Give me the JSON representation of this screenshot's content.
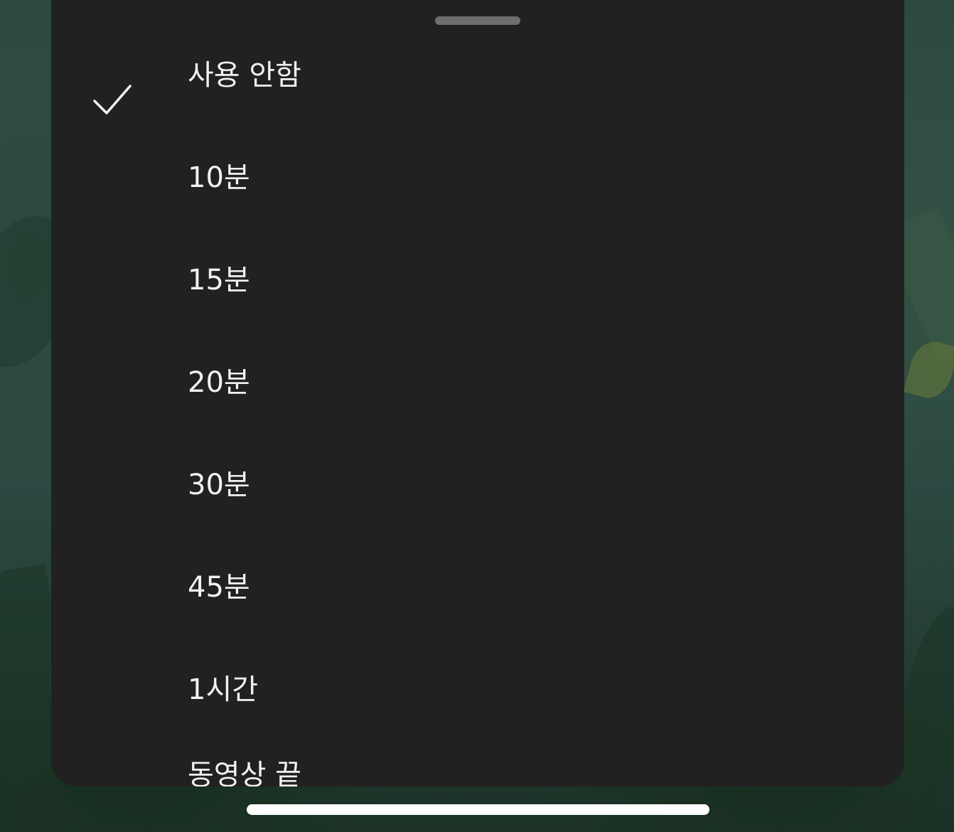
{
  "sleep_timer_sheet": {
    "options": [
      {
        "label": "사용 안함",
        "selected": true
      },
      {
        "label": "10분",
        "selected": false
      },
      {
        "label": "15분",
        "selected": false
      },
      {
        "label": "20분",
        "selected": false
      },
      {
        "label": "30분",
        "selected": false
      },
      {
        "label": "45분",
        "selected": false
      },
      {
        "label": "1시간",
        "selected": false
      },
      {
        "label": "동영상 끝",
        "selected": false
      }
    ],
    "selected_icon": "checkmark-icon"
  },
  "colors": {
    "sheet_background": "#212121",
    "text": "#f1f1f1",
    "handle": "#6e6e6e",
    "home_indicator": "#ffffff"
  }
}
